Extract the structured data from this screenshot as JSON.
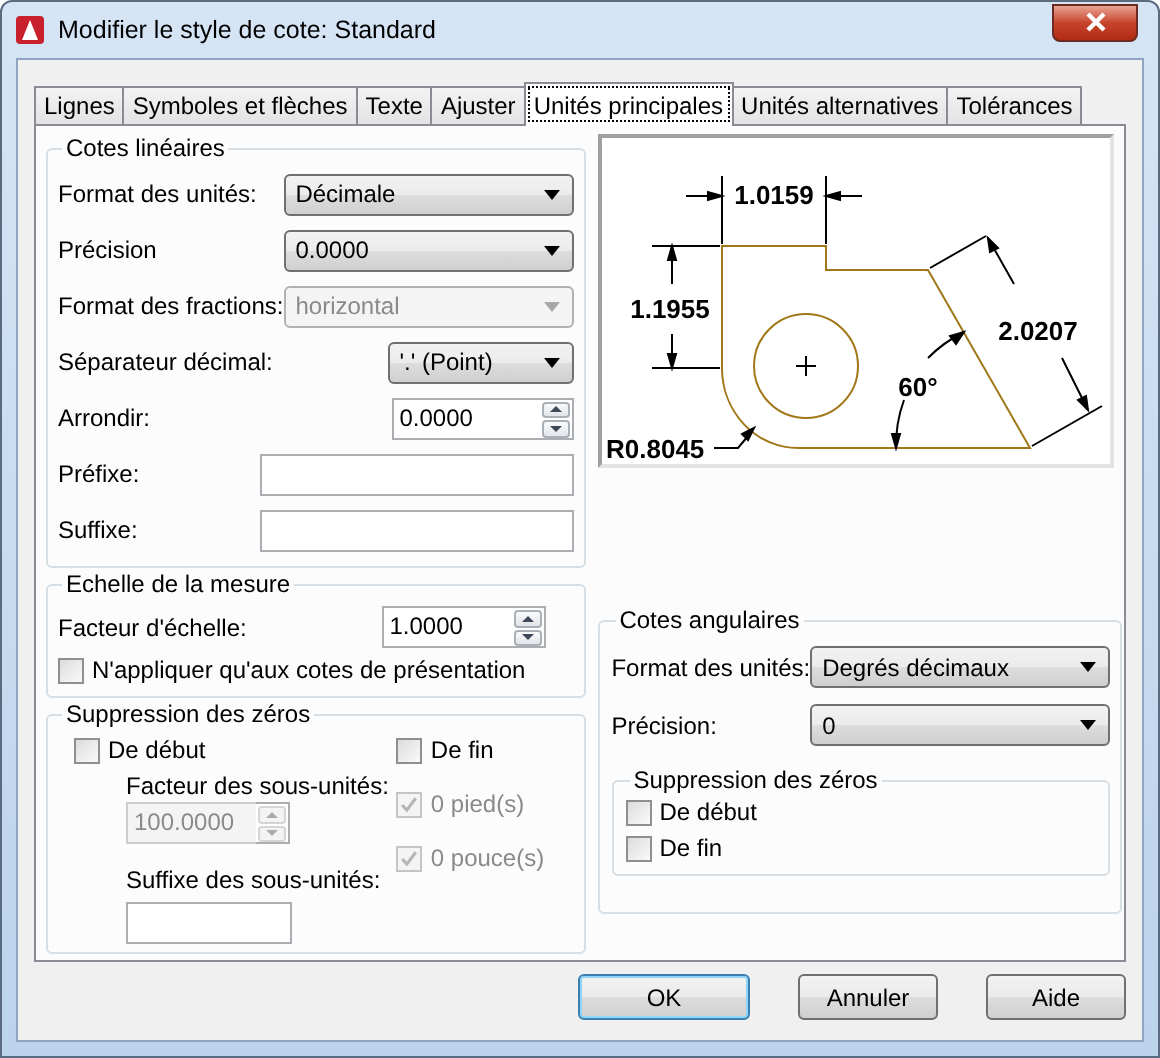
{
  "window": {
    "title": "Modifier le style de cote: Standard"
  },
  "tabs": [
    {
      "label": "Lignes",
      "selected": false
    },
    {
      "label": "Symboles et flèches",
      "selected": false
    },
    {
      "label": "Texte",
      "selected": false
    },
    {
      "label": "Ajuster",
      "selected": false
    },
    {
      "label": "Unités principales",
      "selected": true
    },
    {
      "label": "Unités alternatives",
      "selected": false
    },
    {
      "label": "Tolérances",
      "selected": false
    }
  ],
  "linear_dimensions": {
    "title": "Cotes linéaires",
    "fields": [
      {
        "kind": "dropdown",
        "label": "Format des unités:",
        "value": "Décimale",
        "disabled": false
      },
      {
        "kind": "dropdown",
        "label": "Précision",
        "value": "0.0000",
        "disabled": false
      },
      {
        "kind": "dropdown",
        "label": "Format des fractions:",
        "value": "horizontal",
        "disabled": true
      },
      {
        "kind": "compact",
        "label": "Séparateur décimal:",
        "value": "'.' (Point)",
        "disabled": false
      },
      {
        "kind": "spinner",
        "label": "Arrondir:",
        "value": "0.0000",
        "disabled": false
      },
      {
        "kind": "text",
        "label": "Préfixe:"
      },
      {
        "kind": "text",
        "label": "Suffixe:"
      }
    ]
  },
  "measurement_scale": {
    "title": "Echelle de la mesure",
    "factor": {
      "label": "Facteur d'échelle:",
      "value": "1.0000",
      "disabled": false
    },
    "layout_only": {
      "label": "N'appliquer qu'aux cotes de présentation",
      "checked": false,
      "disabled": false
    }
  },
  "zero_suppression": {
    "title": "Suppression des zéros",
    "leading": {
      "label": "De début",
      "checked": false,
      "disabled": false
    },
    "trailing": {
      "label": "De fin",
      "checked": false,
      "disabled": false
    },
    "sub_units_factor": {
      "label": "Facteur des sous-unités:",
      "value": "100.0000",
      "disabled": true
    },
    "sub_units_suffix": {
      "label": "Suffixe des sous-unités:"
    },
    "feet": {
      "label": "0 pied(s)",
      "checked": true,
      "disabled": true
    },
    "inches": {
      "label": "0 pouce(s)",
      "checked": true,
      "disabled": true
    }
  },
  "preview": {
    "labels": [
      "1.0159",
      "1.1955",
      "2.0207",
      "60°",
      "R0.8045"
    ]
  },
  "angular_dimensions": {
    "title": "Cotes angulaires",
    "fields": [
      {
        "kind": "dropdown",
        "label": "Format des unités:",
        "value": "Degrés décimaux",
        "disabled": false
      },
      {
        "kind": "dropdown",
        "label": "Précision:",
        "value": "0",
        "disabled": false
      }
    ],
    "zero_suppression": {
      "title": "Suppression des zéros",
      "options": [
        {
          "label": "De début",
          "checked": false,
          "disabled": false
        },
        {
          "label": "De fin",
          "checked": false,
          "disabled": false
        }
      ]
    }
  },
  "buttons": [
    {
      "label": "OK",
      "default": true
    },
    {
      "label": "Annuler",
      "default": false
    },
    {
      "label": "Aide",
      "default": false
    }
  ]
}
